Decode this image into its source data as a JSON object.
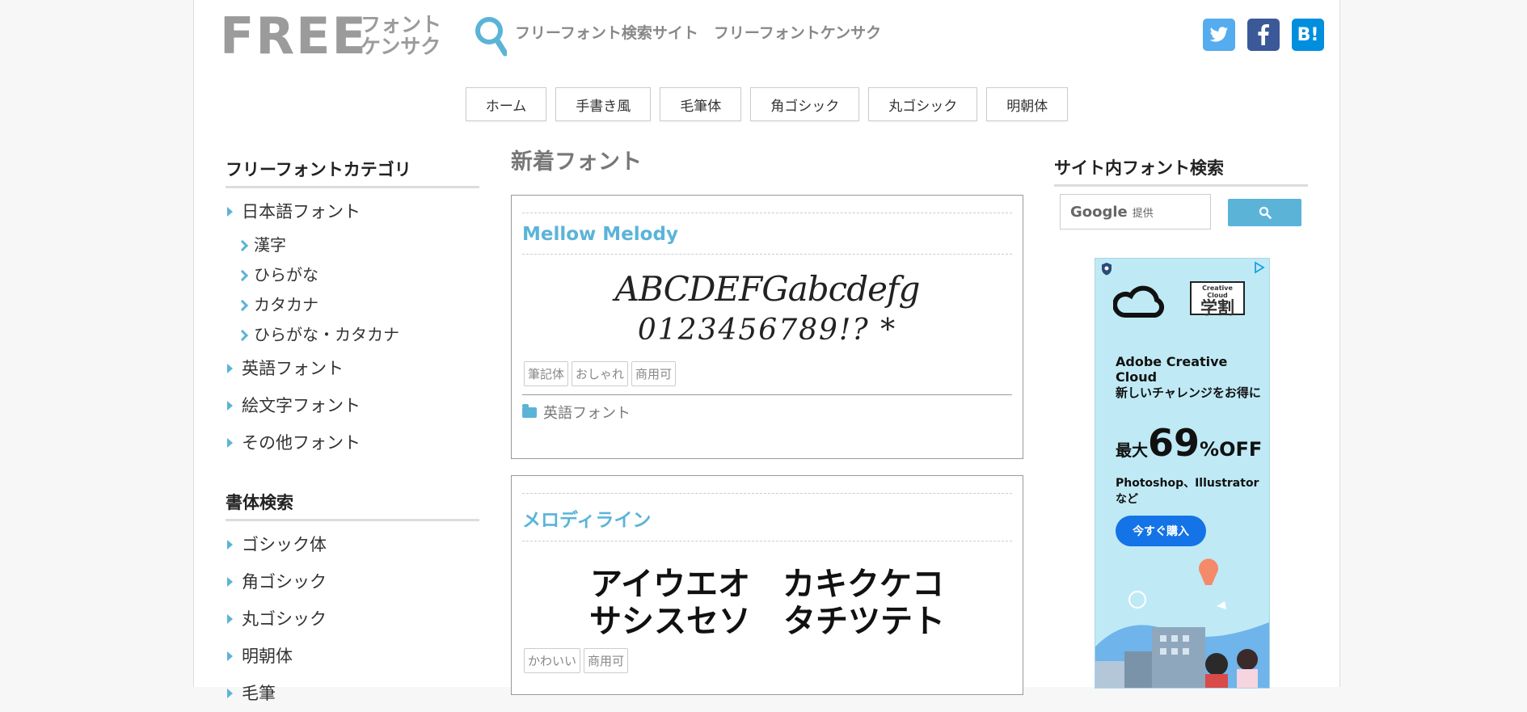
{
  "header": {
    "logo_free": "FREE",
    "logo_jp_line1": "フォント",
    "logo_jp_line2": "ケンサク",
    "tagline": "フリーフォント検索サイト　フリーフォントケンサク"
  },
  "social": {
    "twitter_icon": "twitter-icon",
    "facebook_icon": "facebook-icon",
    "hatena_label": "B!"
  },
  "nav": [
    "ホーム",
    "手書き風",
    "毛筆体",
    "角ゴシック",
    "丸ゴシック",
    "明朝体"
  ],
  "sidebar": {
    "category_title": "フリーフォントカテゴリ",
    "categories": {
      "japanese": "日本語フォント",
      "kanji": "漢字",
      "hiragana": "ひらがな",
      "katakana": "カタカナ",
      "hirakata": "ひらがな・カタカナ",
      "english": "英語フォント",
      "emoji": "絵文字フォント",
      "other": "その他フォント"
    },
    "style_title": "書体検索",
    "styles": [
      "ゴシック体",
      "角ゴシック",
      "丸ゴシック",
      "明朝体",
      "毛筆"
    ]
  },
  "main": {
    "heading": "新着フォント",
    "posts": [
      {
        "title": "Mellow Melody",
        "sample_line1": "ABCDEFGabcdefg",
        "sample_line2": "0123456789!? *",
        "tags": [
          "筆記体",
          "おしゃれ",
          "商用可"
        ],
        "category": "英語フォント"
      },
      {
        "title": "メロディライン",
        "sample_line1": "アイウエオ　カキクケコ",
        "sample_line2": "サシスセソ　タチツテト",
        "tags": [
          "かわいい",
          "商用可"
        ]
      }
    ]
  },
  "right": {
    "search_title": "サイト内フォント検索",
    "google_label": "Google",
    "powered": "提供",
    "ad": {
      "brand_label": "Creative Cloud",
      "badge_label": "学割",
      "headline": "Adobe Creative Cloud",
      "copy": "新しいチャレンジをお得に",
      "discount_prefix": "最大",
      "discount_number": "69",
      "discount_suffix": "%OFF",
      "apps": "Photoshop、Illustratorなど",
      "cta": "今すぐ購入"
    }
  }
}
